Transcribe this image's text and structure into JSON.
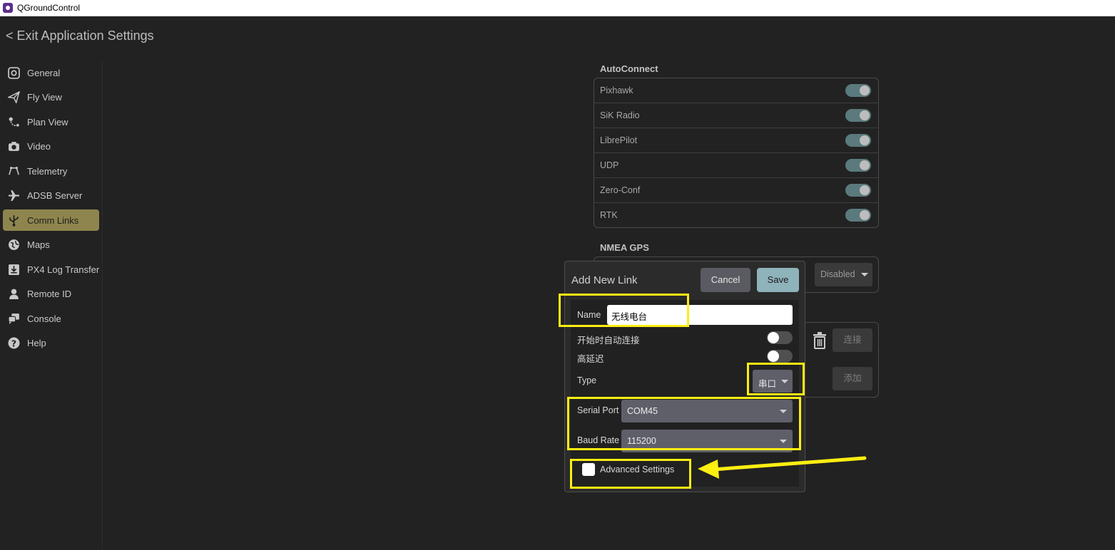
{
  "window": {
    "title": "QGroundControl",
    "icon": "qgc-app-icon"
  },
  "header": {
    "exit_label": "< Exit Application Settings"
  },
  "sidebar": {
    "items": [
      {
        "label": "General",
        "icon": "gear-icon",
        "active": false
      },
      {
        "label": "Fly View",
        "icon": "paper-plane-icon",
        "active": false
      },
      {
        "label": "Plan View",
        "icon": "route-icon",
        "active": false
      },
      {
        "label": "Video",
        "icon": "camera-icon",
        "active": false
      },
      {
        "label": "Telemetry",
        "icon": "antenna-icon",
        "active": false
      },
      {
        "label": "ADSB Server",
        "icon": "airplane-icon",
        "active": false
      },
      {
        "label": "Comm Links",
        "icon": "usb-icon",
        "active": true
      },
      {
        "label": "Maps",
        "icon": "globe-icon",
        "active": false
      },
      {
        "label": "PX4 Log Transfer",
        "icon": "download-icon",
        "active": false
      },
      {
        "label": "Remote ID",
        "icon": "person-icon",
        "active": false
      },
      {
        "label": "Console",
        "icon": "chat-icon",
        "active": false
      },
      {
        "label": "Help",
        "icon": "question-icon",
        "active": false
      }
    ]
  },
  "autoconnect": {
    "title": "AutoConnect",
    "items": [
      {
        "label": "Pixhawk",
        "enabled": true
      },
      {
        "label": "SiK Radio",
        "enabled": true
      },
      {
        "label": "LibrePilot",
        "enabled": true
      },
      {
        "label": "UDP",
        "enabled": true
      },
      {
        "label": "Zero-Conf",
        "enabled": true
      },
      {
        "label": "RTK",
        "enabled": true
      }
    ]
  },
  "nmea": {
    "title": "NMEA GPS",
    "selected": "Disabled"
  },
  "links": {
    "connect_label": "连接",
    "add_label": "添加"
  },
  "dialog": {
    "title": "Add New Link",
    "cancel_label": "Cancel",
    "save_label": "Save",
    "name_label": "Name",
    "name_value": "无线电台",
    "autoconnect_label": "开始时自动连接",
    "autoconnect_on": false,
    "high_latency_label": "高延迟",
    "high_latency_on": false,
    "type_label": "Type",
    "type_value": "串口",
    "serial_port_label": "Serial Port",
    "serial_port_value": "COM45",
    "baud_rate_label": "Baud Rate",
    "baud_rate_value": "115200",
    "advanced_label": "Advanced Settings",
    "advanced_checked": false
  },
  "colors": {
    "highlight": "#ffee11",
    "active_nav": "#8e854e",
    "toggle_on": "#5b7a7d",
    "save_button": "#8fb3ba"
  }
}
